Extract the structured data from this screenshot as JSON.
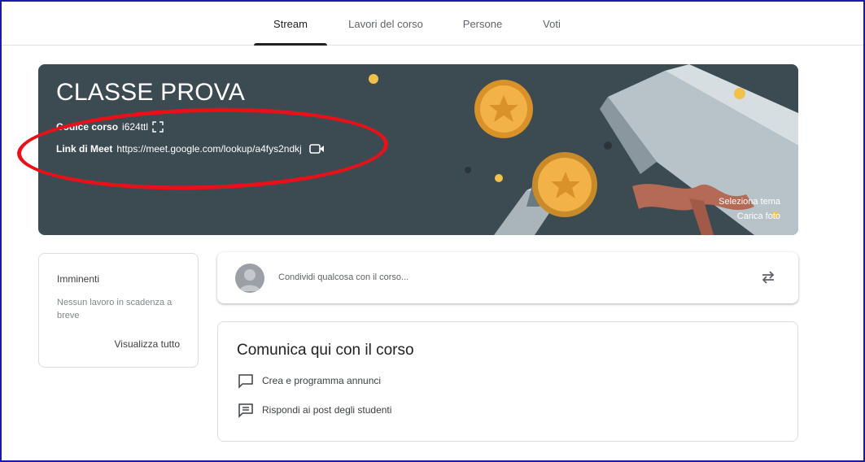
{
  "tabs": [
    {
      "label": "Stream",
      "active": true
    },
    {
      "label": "Lavori del corso",
      "active": false
    },
    {
      "label": "Persone",
      "active": false
    },
    {
      "label": "Voti",
      "active": false
    }
  ],
  "banner": {
    "title": "CLASSE PROVA",
    "course_code_label": "Codice corso",
    "course_code_value": "i624ttl",
    "meet_label": "Link di Meet",
    "meet_url": "https://meet.google.com/lookup/a4fys2ndkj",
    "select_theme": "Seleziona tema",
    "upload_photo": "Carica foto",
    "bg_color": "#3c4a52"
  },
  "annotation": {
    "color": "#e8111a",
    "shape": "ellipse"
  },
  "upcoming": {
    "title": "Imminenti",
    "text": "Nessun lavoro in scadenza a breve",
    "link": "Visualizza tutto"
  },
  "share": {
    "placeholder": "Condividi qualcosa con il corso...",
    "avatar_icon": "avatar-icon",
    "repost_icon": "repost-icon"
  },
  "communicate": {
    "title": "Comunica qui con il corso",
    "items": [
      {
        "label": "Crea e programma annunci",
        "icon": "announcement-icon"
      },
      {
        "label": "Rispondi ai post degli studenti",
        "icon": "reply-posts-icon"
      }
    ]
  }
}
